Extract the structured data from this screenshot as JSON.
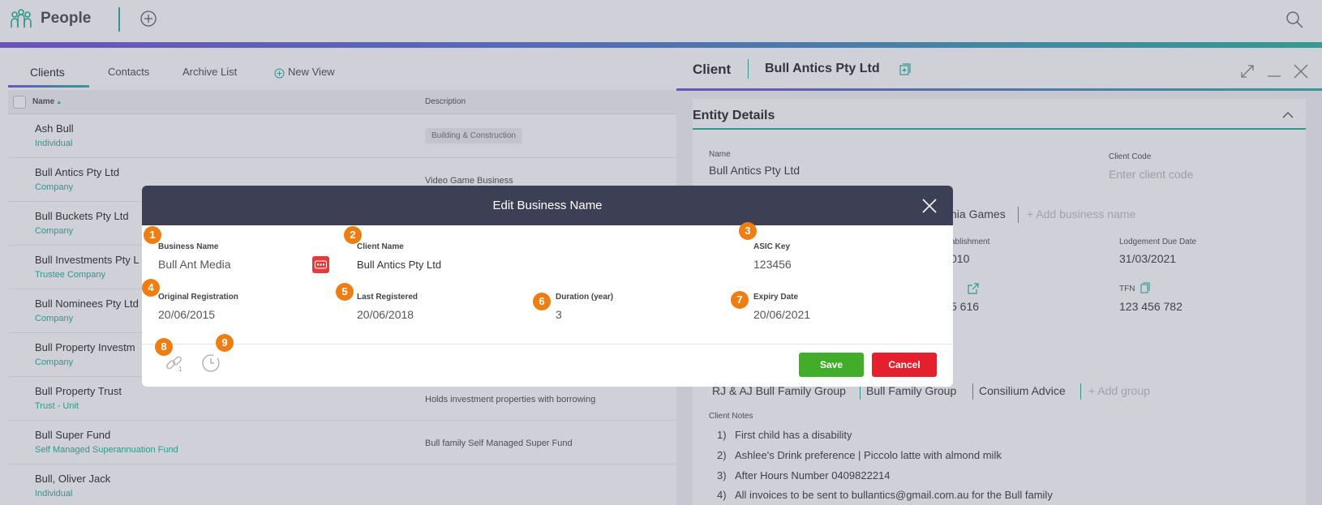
{
  "app": {
    "title": "People"
  },
  "left_panel": {
    "tabs": [
      {
        "label": "Clients"
      },
      {
        "label": "Contacts"
      },
      {
        "label": "Archive List"
      },
      {
        "label": "New View"
      }
    ],
    "columns": {
      "name": "Name",
      "description": "Description"
    },
    "rows": [
      {
        "name": "Ash Bull",
        "type": "Individual",
        "description": "Building & Construction"
      },
      {
        "name": "Bull Antics Pty Ltd",
        "type": "Company",
        "description": "Video Game Business"
      },
      {
        "name": "Bull Buckets Pty Ltd",
        "type": "Company",
        "description": ""
      },
      {
        "name": "Bull Investments Pty L",
        "type": "Trustee Company",
        "description": ""
      },
      {
        "name": "Bull Nominees Pty Ltd",
        "type": "Company",
        "description": ""
      },
      {
        "name": "Bull Property Investm",
        "type": "Company",
        "description": ""
      },
      {
        "name": "Bull Property Trust",
        "type": "Trust - Unit",
        "description": "Holds investment properties with borrowing"
      },
      {
        "name": "Bull Super Fund",
        "type": "Self Managed Superannuation Fund",
        "description": "Bull family Self Managed Super Fund"
      },
      {
        "name": "Bull, Oliver Jack",
        "type": "Individual",
        "description": ""
      }
    ]
  },
  "right_panel": {
    "header": {
      "label": "Client",
      "name": "Bull Antics Pty Ltd"
    },
    "entity": {
      "title": "Entity Details",
      "name_label": "Name",
      "name_value": "Bull Antics Pty Ltd",
      "client_code_label": "Client Code",
      "client_code_placeholder": "Enter client code",
      "business_name_partial": "nia Games",
      "add_business_name": "+ Add business name",
      "establishment_label": "ablishment",
      "establishment_value": "010",
      "lodgement_label": "Lodgement Due Date",
      "lodgement_value": "31/03/2021",
      "abn_partial": "5 616",
      "tfn_label": "TFN",
      "tfn_value": "123 456 782",
      "groups": [
        "RJ & AJ Bull Family Group",
        "Bull Family Group",
        "Consilium Advice"
      ],
      "add_group": "+ Add group",
      "client_notes_label": "Client Notes",
      "notes": [
        {
          "num": "1)",
          "text": "First child has a disability"
        },
        {
          "num": "2)",
          "text": "Ashlee's Drink preference | Piccolo latte with almond milk"
        },
        {
          "num": "3)",
          "text": "After Hours Number 0409822214"
        },
        {
          "num": "4)",
          "text": "All invoices to be sent to bullantics@gmail.com.au for the Bull family"
        }
      ]
    }
  },
  "modal": {
    "title": "Edit Business Name",
    "fields": {
      "business_name_label": "Business Name",
      "business_name_value": "Bull Ant Media",
      "client_name_label": "Client Name",
      "client_name_value": "Bull Antics Pty Ltd",
      "asic_key_label": "ASIC Key",
      "asic_key_value": "123456",
      "original_registration_label": "Original Registration",
      "original_registration_value": "20/06/2015",
      "last_registered_label": "Last Registered",
      "last_registered_value": "20/06/2018",
      "duration_label": "Duration (year)",
      "duration_value": "3",
      "expiry_date_label": "Expiry Date",
      "expiry_date_value": "20/06/2021"
    },
    "markers": [
      "1",
      "2",
      "3",
      "4",
      "5",
      "6",
      "7",
      "8",
      "9"
    ],
    "link_count": "1",
    "save_label": "Save",
    "cancel_label": "Cancel"
  },
  "colors": {
    "accent": "#2fb59a",
    "modal_header": "#3d4055",
    "save": "#42ad2a",
    "cancel": "#e5202e",
    "marker": "#ee7d12"
  }
}
